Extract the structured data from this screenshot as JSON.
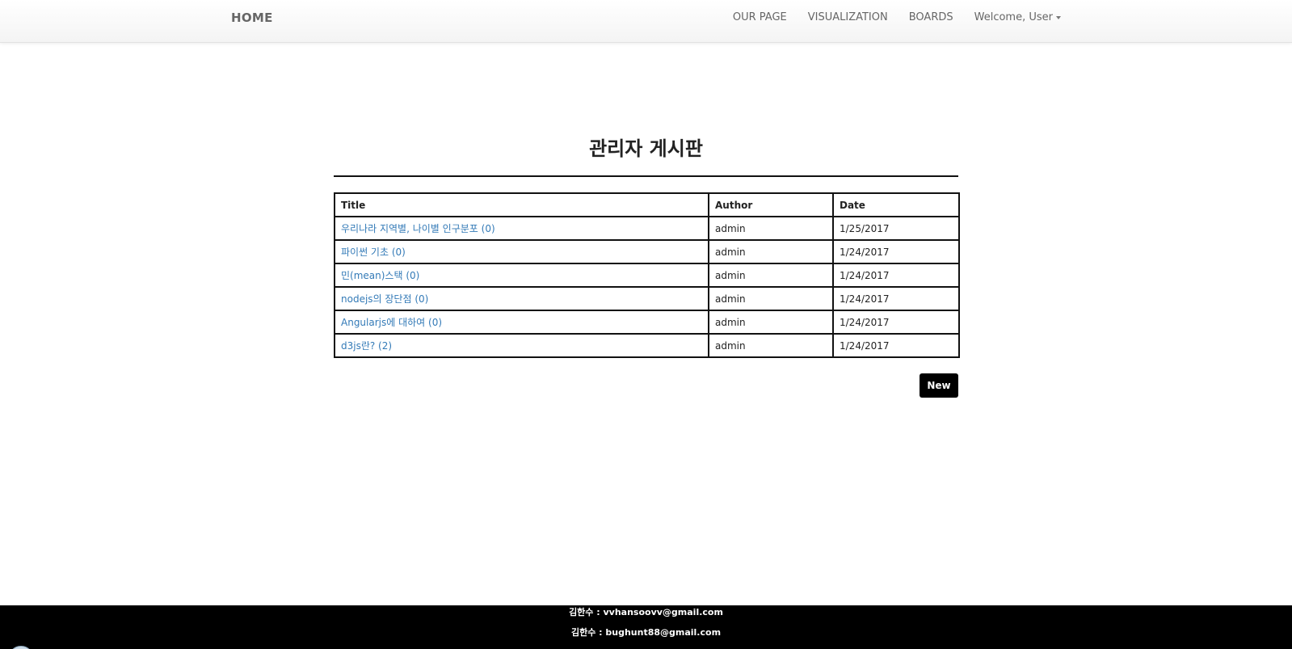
{
  "navbar": {
    "brand": "HOME",
    "links": [
      {
        "label": "OUR PAGE"
      },
      {
        "label": "VISUALIZATION"
      },
      {
        "label": "BOARDS"
      }
    ],
    "user_menu": {
      "label": "Welcome, User"
    }
  },
  "board": {
    "title": "관리자 게시판",
    "columns": {
      "title": "Title",
      "author": "Author",
      "date": "Date"
    },
    "rows": [
      {
        "title": "우리나라 지역별, 나이별 인구분포  (0)",
        "author": "admin",
        "date": "1/25/2017"
      },
      {
        "title": "파이썬 기초  (0)",
        "author": "admin",
        "date": "1/24/2017"
      },
      {
        "title": "민(mean)스택  (0)",
        "author": "admin",
        "date": "1/24/2017"
      },
      {
        "title": "nodejs의 장단점  (0)",
        "author": "admin",
        "date": "1/24/2017"
      },
      {
        "title": "Angularjs에 대하여  (0)",
        "author": "admin",
        "date": "1/24/2017"
      },
      {
        "title": "d3js란?  (2)",
        "author": "admin",
        "date": "1/24/2017"
      }
    ],
    "new_button": "New"
  },
  "footer": {
    "line1": "김한수 : vvhansoovv@gmail.com",
    "line2": "김한수 : bughunt88@gmail.com"
  },
  "colors": {
    "link": "#337ab7",
    "footer_bg": "#000000",
    "button_bg": "#000000"
  }
}
